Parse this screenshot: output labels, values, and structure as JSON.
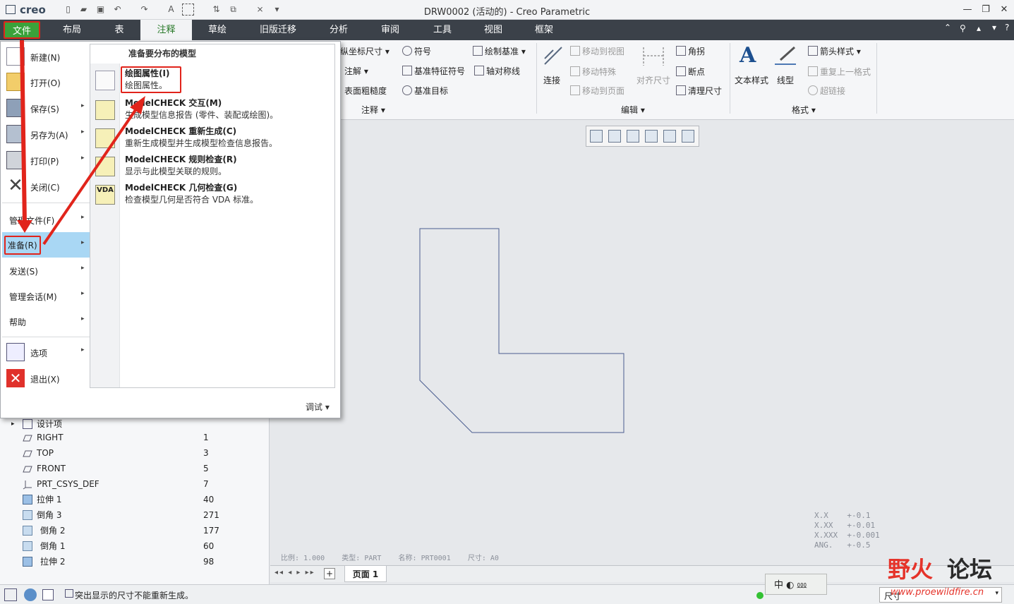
{
  "titlebar": {
    "logo": "creo",
    "title": "DRW0002 (活动的) - Creo Parametric",
    "window_buttons": {
      "minimize": "—",
      "restore": "❐",
      "close": "✕"
    }
  },
  "tabs": [
    {
      "label": "布局"
    },
    {
      "label": "表"
    },
    {
      "label": "注释"
    },
    {
      "label": "草绘"
    },
    {
      "label": "旧版迁移"
    },
    {
      "label": "分析"
    },
    {
      "label": "审阅"
    },
    {
      "label": "工具"
    },
    {
      "label": "视图"
    },
    {
      "label": "框架"
    }
  ],
  "file_button": {
    "label": "文件"
  },
  "ribbon": {
    "annot": {
      "ordinate_dim": "纵坐标尺寸",
      "symbol": "符号",
      "draw_datum": "绘制基准",
      "note": "注解",
      "datum_feature_symbol": "基准特征符号",
      "axis_symmetry": "轴对称线",
      "surface_finish": "表面粗糙度",
      "datum_target": "基准目标",
      "group": "注释"
    },
    "edit": {
      "connect": "连接",
      "move_to_view": "移动到视图",
      "move_special": "移动特殊",
      "move_to_page": "移动到页面",
      "align_dims": "对齐尺寸",
      "corner": "角拐",
      "breakpoint": "断点",
      "cleanup_dims": "清理尺寸",
      "group": "编辑"
    },
    "format": {
      "text_style": "文本样式",
      "line_style": "线型",
      "arrow_style": "箭头样式",
      "repeat_last_format": "重复上一格式",
      "hyperlink": "超链接",
      "group": "格式"
    }
  },
  "file_menu": {
    "items": [
      {
        "label": "新建(N)"
      },
      {
        "label": "打开(O)"
      },
      {
        "label": "保存(S)"
      },
      {
        "label": "另存为(A)"
      },
      {
        "label": "打印(P)"
      },
      {
        "label": "关闭(C)"
      },
      {
        "label": "管理文件(F)"
      },
      {
        "label": "准备(R)"
      },
      {
        "label": "发送(S)"
      },
      {
        "label": "管理会话(M)"
      },
      {
        "label": "帮助"
      },
      {
        "label": "选项"
      },
      {
        "label": "退出(X)"
      }
    ],
    "submenu": {
      "header": "准备要分布的模型",
      "items": [
        {
          "title": "绘图属性(I)",
          "desc": "绘图属性。"
        },
        {
          "title": "ModelCHECK 交互(M)",
          "desc": "生成模型信息报告 (零件、装配或绘图)。"
        },
        {
          "title": "ModelCHECK 重新生成(C)",
          "desc": "重新生成模型并生成模型检查信息报告。"
        },
        {
          "title": "ModelCHECK 规则检查(R)",
          "desc": "显示与此模型关联的规则。"
        },
        {
          "title": "ModelCHECK 几何检查(G)",
          "desc": "检查模型几何是否符合 VDA 标准。"
        }
      ],
      "vda_label": "VDA"
    },
    "debug": "调试"
  },
  "model_tree": {
    "rows": [
      {
        "label": "设计项",
        "num": ""
      },
      {
        "label": "RIGHT",
        "num": "1"
      },
      {
        "label": "TOP",
        "num": "3"
      },
      {
        "label": "FRONT",
        "num": "5"
      },
      {
        "label": "PRT_CSYS_DEF",
        "num": "7"
      },
      {
        "label": "拉伸 1",
        "num": "40"
      },
      {
        "label": "倒角 3",
        "num": "271"
      },
      {
        "label": "倒角 2",
        "num": "177"
      },
      {
        "label": "倒角 1",
        "num": "60"
      },
      {
        "label": "拉伸 2",
        "num": "98"
      }
    ]
  },
  "drawing": {
    "tolerances": [
      "X.X    +-0.1",
      "X.XX   +-0.01",
      "X.XXX  +-0.001",
      "ANG.   +-0.5"
    ],
    "info": {
      "scale_label": "比例:",
      "scale": "1.000",
      "type_label": "类型:",
      "type": "PART",
      "name_label": "名称:",
      "name": "PRT0001",
      "size_label": "尺寸:",
      "size": "A0"
    }
  },
  "page_tabs": {
    "page1": "页面 1",
    "add": "+"
  },
  "status": {
    "message": "突出显示的尺寸不能重新生成。",
    "ime": "中",
    "filter": "尺寸"
  },
  "watermark": {
    "text1": "野火",
    "text2": "论坛",
    "url": "www.proewildfire.cn"
  },
  "colors": {
    "accent_green": "#3aa23a",
    "tabbar": "#3b4149",
    "highlight_red": "#e1241b",
    "selection_blue": "#a9d7f4"
  }
}
